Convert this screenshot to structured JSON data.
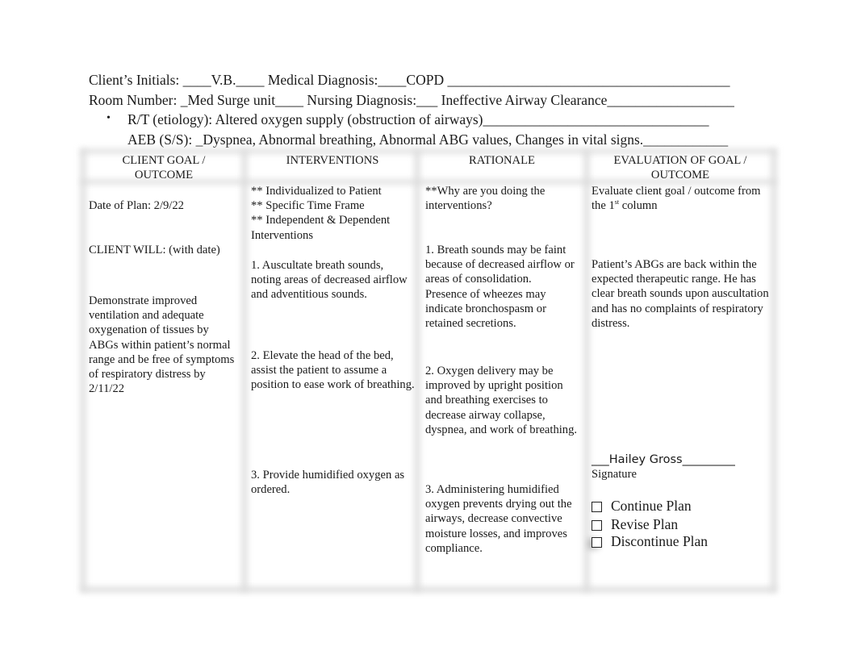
{
  "header": {
    "line1": "Client’s Initials: ____V.B.____ Medical Diagnosis:____COPD ________________________________________",
    "line2": "Room Number: _Med Surge unit____ Nursing Diagnosis:___ Ineffective Airway Clearance__________________",
    "line3": "R/T (etiology):  Altered oxygen supply (obstruction of airways)________________________________",
    "line4": "AEB (S/S): _Dyspnea, Abnormal breathing, Abnormal ABG values, Changes in vital signs.____________",
    "bullet": "•",
    "fields": {
      "client_initials": "V.B.",
      "medical_diagnosis": "COPD",
      "room_number": "Med Surge unit",
      "nursing_diagnosis": "Ineffective Airway Clearance",
      "related_to": "Altered oxygen supply (obstruction of airways)",
      "as_evidenced_by": "Dyspnea, Abnormal breathing, Abnormal ABG values, Changes in vital signs."
    }
  },
  "table": {
    "columns": [
      {
        "line1": "CLIENT GOAL /",
        "line2": "OUTCOME"
      },
      {
        "line1": "INTERVENTIONS",
        "line2": ""
      },
      {
        "line1": "RATIONALE",
        "line2": ""
      },
      {
        "line1": "EVALUATION OF GOAL /",
        "line2": "OUTCOME"
      }
    ],
    "goal": {
      "date_of_plan": "Date of Plan:  2/9/22",
      "client_will": "CLIENT WILL:  (with date)",
      "outcome": "Demonstrate improved ventilation and adequate oxygenation of tissues by ABGs within patient’s normal range and be free of symptoms of respiratory distress by 2/11/22"
    },
    "interventions": {
      "guidelines": [
        "** Individualized to Patient",
        "** Specific Time Frame",
        "** Independent & Dependent Interventions"
      ],
      "items": [
        "1. Auscultate breath sounds, noting areas of decreased airflow and adventitious sounds.",
        "2.  Elevate the head of the bed, assist the patient to assume a position to ease work of breathing.",
        "3. Provide humidified oxygen as ordered."
      ]
    },
    "rationale": {
      "prompt": "**Why are you doing the interventions?",
      "items": [
        "1. Breath sounds may be faint because of decreased airflow or areas of consolidation. Presence of wheezes may indicate bronchospasm or retained secretions.",
        "2. Oxygen delivery may be improved by upright position and breathing exercises to decrease airway collapse, dyspnea, and work of breathing.",
        "3. Administering humidified oxygen prevents drying out the airways, decrease convective moisture losses, and improves compliance."
      ]
    },
    "evaluation": {
      "prompt_text": "Evaluate client goal / outcome from the 1",
      "prompt_sup": "st",
      "prompt_end": " column",
      "text": "Patient’s ABGs are back within the expected therapeutic range. He has clear breath sounds upon auscultation and has no complaints of respiratory distress.",
      "signature_value": "___Hailey Gross_________",
      "signature_label": "Signature",
      "options": [
        {
          "label": "Continue Plan",
          "checked": false
        },
        {
          "label": "Revise Plan",
          "checked": false
        },
        {
          "label": "Discontinue Plan",
          "checked": false
        }
      ]
    }
  }
}
